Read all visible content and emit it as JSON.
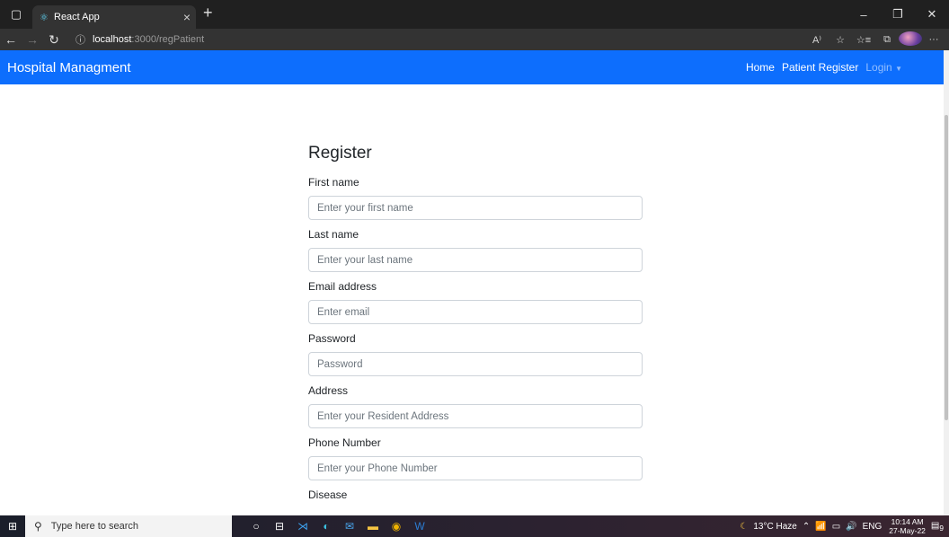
{
  "browser": {
    "tab_title": "React App",
    "tab_favicon": "react-icon",
    "url_host": "localhost",
    "url_path": ":3000/regPatient",
    "actions": [
      "read-aloud-icon",
      "favorite-icon",
      "favorites-list-icon",
      "collections-icon",
      "profile-avatar",
      "more-icon"
    ]
  },
  "app": {
    "brand": "Hospital Managment",
    "nav": {
      "home": "Home",
      "patient_register": "Patient Register",
      "login": "Login"
    },
    "accent_color": "#0d6efd"
  },
  "form": {
    "title": "Register",
    "fields": [
      {
        "label": "First name",
        "placeholder": "Enter your first name"
      },
      {
        "label": "Last name",
        "placeholder": "Enter your last name"
      },
      {
        "label": "Email address",
        "placeholder": "Enter email"
      },
      {
        "label": "Password",
        "placeholder": "Password"
      },
      {
        "label": "Address",
        "placeholder": "Enter your Resident Address"
      },
      {
        "label": "Phone Number",
        "placeholder": "Enter your Phone Number"
      },
      {
        "label": "Disease"
      }
    ]
  },
  "taskbar": {
    "search_placeholder": "Type here to search",
    "weather": "13°C Haze",
    "language": "ENG",
    "time": "10:14 AM",
    "date": "27-May-22",
    "notification_count": "9"
  }
}
